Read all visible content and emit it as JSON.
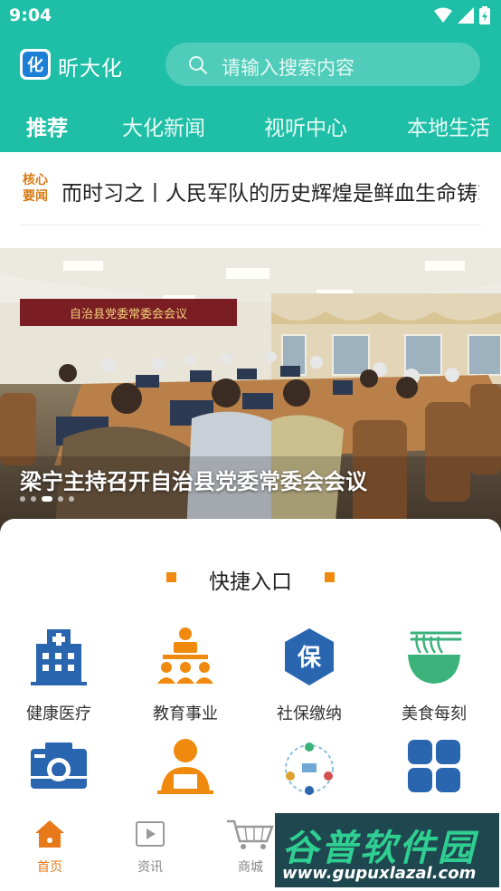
{
  "status": {
    "time": "9:04"
  },
  "header": {
    "app_title": "昕大化",
    "logo_text": "化"
  },
  "search": {
    "placeholder": "请输入搜索内容"
  },
  "tabs": [
    {
      "label": "推荐",
      "active": true
    },
    {
      "label": "大化新闻",
      "active": false
    },
    {
      "label": "视听中心",
      "active": false
    },
    {
      "label": "本地生活",
      "active": false
    }
  ],
  "news": {
    "tag_line1": "核心",
    "tag_line2": "要闻",
    "headline": "而时习之丨人民军队的历史辉煌是鲜血生命铸就的"
  },
  "banner": {
    "caption": "梁宁主持召开自治县党委常委会会议",
    "sign_text": "自治县党委常委会会议",
    "dot_count": 5,
    "active_dot": 2
  },
  "quick_entry": {
    "title": "快捷入口",
    "items": [
      {
        "label": "健康医疗",
        "icon": "hospital-icon"
      },
      {
        "label": "教育事业",
        "icon": "education-icon"
      },
      {
        "label": "社保缴纳",
        "icon": "social-security-icon",
        "glyph": "保"
      },
      {
        "label": "美食每刻",
        "icon": "food-bowl-icon"
      },
      {
        "label": "",
        "icon": "camera-icon"
      },
      {
        "label": "",
        "icon": "service-person-icon"
      },
      {
        "label": "",
        "icon": "map-route-icon"
      },
      {
        "label": "",
        "icon": "apps-grid-icon"
      }
    ]
  },
  "bottom_nav": [
    {
      "label": "首页",
      "icon": "home-icon",
      "active": true
    },
    {
      "label": "资讯",
      "icon": "video-news-icon",
      "active": false
    },
    {
      "label": "商城",
      "icon": "cart-icon",
      "active": false
    }
  ],
  "watermark": {
    "title": "谷普软件园",
    "url": "www.gupuxlazal.com"
  },
  "colors": {
    "brand": "#1fbfa7",
    "accent": "#f08a0e",
    "icon_blue": "#2a66b0"
  }
}
